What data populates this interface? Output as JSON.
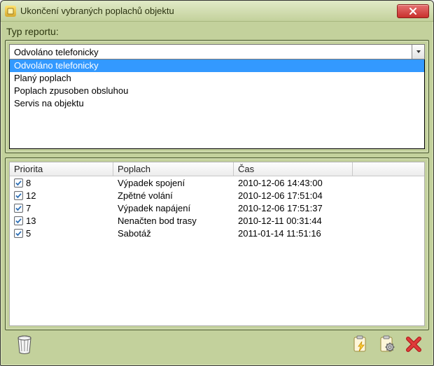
{
  "window": {
    "title": "Ukončení vybraných poplachů objektu"
  },
  "typeLabel": "Typ reportu:",
  "combo": {
    "value": "Odvoláno telefonicky",
    "options": [
      "Odvoláno telefonicky",
      "Planý poplach",
      "Poplach zpusoben obsluhou",
      "Servis na objektu"
    ]
  },
  "table": {
    "headers": {
      "prio": "Priorita",
      "pop": "Poplach",
      "cas": "Čas"
    },
    "rows": [
      {
        "checked": true,
        "prio": "8",
        "pop": "Výpadek spojení",
        "cas": "2010-12-06 14:43:00"
      },
      {
        "checked": true,
        "prio": "12",
        "pop": "Zpětné volání",
        "cas": "2010-12-06 17:51:04"
      },
      {
        "checked": true,
        "prio": "7",
        "pop": "Výpadek napájení",
        "cas": "2010-12-06 17:51:37"
      },
      {
        "checked": true,
        "prio": "13",
        "pop": "Nenačten bod trasy",
        "cas": "2010-12-11 00:31:44"
      },
      {
        "checked": true,
        "prio": "5",
        "pop": "Sabotáž",
        "cas": "2011-01-14 11:51:16"
      }
    ]
  },
  "icons": {
    "trash": "trash-icon",
    "apply": "clipboard-lightning-icon",
    "settings": "clipboard-gear-icon",
    "cancel": "cancel-icon"
  }
}
